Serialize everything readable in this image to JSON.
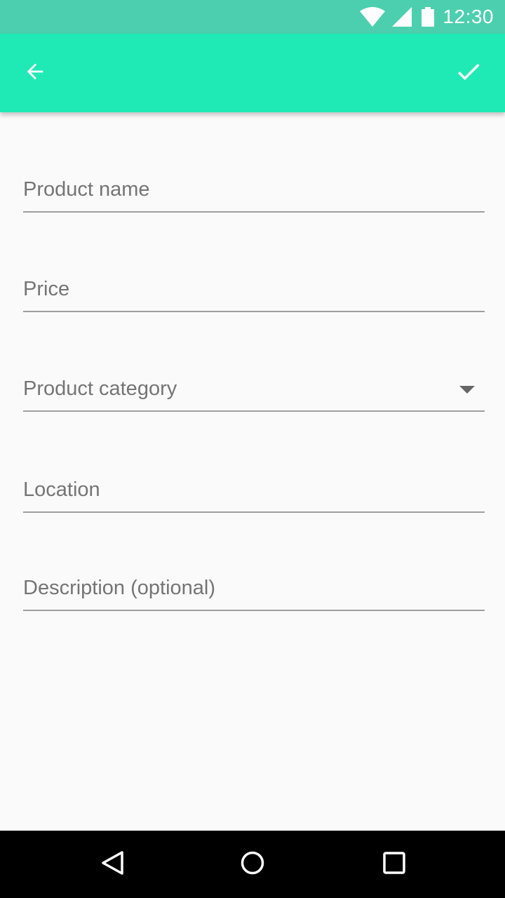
{
  "status_bar": {
    "time": "12:30",
    "icons": [
      "wifi-icon",
      "cell-signal-icon",
      "battery-icon"
    ]
  },
  "app_bar": {
    "background_color": "#1fe9b5",
    "back_icon": "arrow-back-icon",
    "confirm_icon": "check-icon"
  },
  "form": {
    "fields": [
      {
        "placeholder": "Product name",
        "value": ""
      },
      {
        "placeholder": "Price",
        "value": ""
      },
      {
        "placeholder": "Product category",
        "value": "",
        "type": "dropdown"
      },
      {
        "placeholder": "Location",
        "value": ""
      },
      {
        "placeholder": "Description (optional)",
        "value": ""
      }
    ]
  },
  "nav_bar": {
    "buttons": [
      "nav-back-icon",
      "nav-home-icon",
      "nav-recents-icon"
    ]
  },
  "colors": {
    "status_bar": "#4ccfae",
    "app_bar": "#1fe9b5",
    "background": "#fafafa",
    "placeholder_text": "#757575",
    "underline": "#9e9e9e"
  }
}
